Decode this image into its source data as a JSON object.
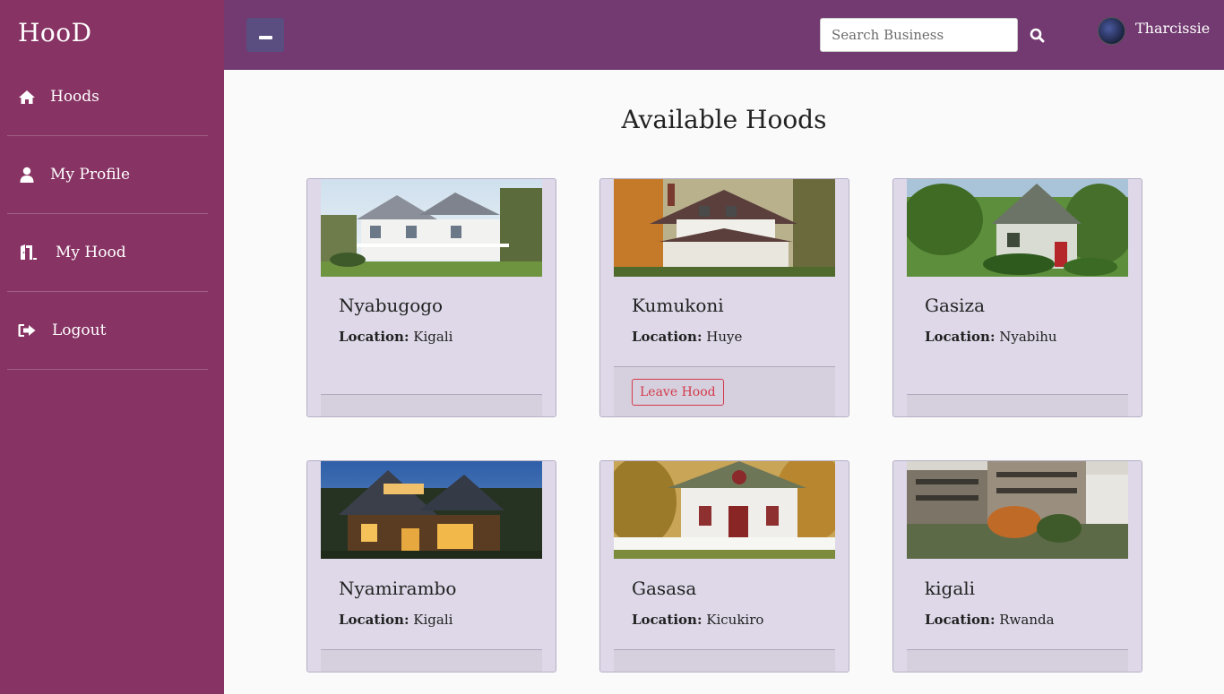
{
  "brand": "HooD",
  "sidebar": {
    "items": [
      {
        "label": "Hoods",
        "icon": "home-icon"
      },
      {
        "label": "My Profile",
        "icon": "user-icon"
      },
      {
        "label": "My Hood",
        "icon": "door-icon"
      },
      {
        "label": "Logout",
        "icon": "sign-out-icon"
      }
    ]
  },
  "topbar": {
    "search_placeholder": "Search Business",
    "username": "Tharcissie"
  },
  "page_title": "Available Hoods",
  "location_label": "Location:",
  "hoods": [
    {
      "name": "Nyabugogo",
      "location": "Kigali",
      "action": null
    },
    {
      "name": "Kumukoni",
      "location": "Huye",
      "action": "Leave Hood"
    },
    {
      "name": "Gasiza",
      "location": "Nyabihu",
      "action": null
    },
    {
      "name": "Nyamirambo",
      "location": "Kigali",
      "action": null
    },
    {
      "name": "Gasasa",
      "location": "Kicukiro",
      "action": null
    },
    {
      "name": "kigali",
      "location": "Rwanda",
      "action": null
    }
  ],
  "colors": {
    "sidebar": "#873363",
    "topbar": "#723a70",
    "card": "#ded8e8",
    "danger": "#d33a4a"
  }
}
